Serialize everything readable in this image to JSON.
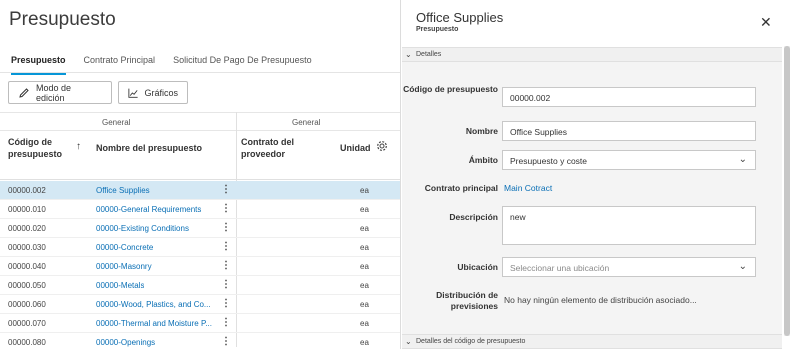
{
  "page": {
    "title": "Presupuesto"
  },
  "tabs": [
    {
      "label": "Presupuesto",
      "active": true
    },
    {
      "label": "Contrato Principal",
      "active": false
    },
    {
      "label": "Solicitud De Pago De Presupuesto",
      "active": false
    }
  ],
  "toolbar": {
    "edit_mode_label": "Modo de edición",
    "charts_label": "Gráficos"
  },
  "grid": {
    "group_left": "General",
    "group_right": "General",
    "headers": {
      "code": "Código de presupuesto",
      "name": "Nombre del presupuesto",
      "contract": "Contrato del proveedor",
      "unit": "Unidad"
    },
    "rows": [
      {
        "code": "00000.002",
        "name": "Office Supplies",
        "unit": "ea",
        "selected": true
      },
      {
        "code": "00000.010",
        "name": "00000-General Requirements",
        "unit": "ea"
      },
      {
        "code": "00000.020",
        "name": "00000-Existing Conditions",
        "unit": "ea"
      },
      {
        "code": "00000.030",
        "name": "00000-Concrete",
        "unit": "ea"
      },
      {
        "code": "00000.040",
        "name": "00000-Masonry",
        "unit": "ea"
      },
      {
        "code": "00000.050",
        "name": "00000-Metals",
        "unit": "ea"
      },
      {
        "code": "00000.060",
        "name": "00000-Wood, Plastics, and Co...",
        "unit": "ea"
      },
      {
        "code": "00000.070",
        "name": "00000-Thermal and Moisture P...",
        "unit": "ea"
      },
      {
        "code": "00000.080",
        "name": "00000-Openings",
        "unit": "ea"
      }
    ]
  },
  "panel": {
    "title": "Office Supplies",
    "subtitle": "Presupuesto",
    "section_details": "Detalles",
    "section_code_details": "Detalles del código de presupuesto",
    "fields": {
      "code_label": "Código de presupuesto",
      "code_value": "00000.002",
      "name_label": "Nombre",
      "name_value": "Office Supplies",
      "scope_label": "Ámbito",
      "scope_value": "Presupuesto y coste",
      "contract_label": "Contrato principal",
      "contract_value": "Main Cotract",
      "description_label": "Descripción",
      "description_value": "new",
      "location_label": "Ubicación",
      "location_placeholder": "Seleccionar una ubicación",
      "distribution_label": "Distribución de previsiones",
      "distribution_value": "No hay ningún elemento de distribución asociado..."
    }
  },
  "colors": {
    "accent": "#0696d7",
    "link": "#0a6fb5",
    "selected_row": "#d4e8f4"
  }
}
